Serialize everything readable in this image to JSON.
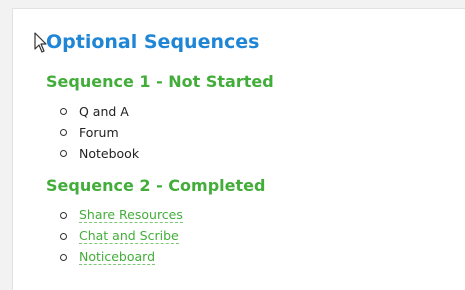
{
  "page_title": "Optional Sequences",
  "sequences": [
    {
      "heading": "Sequence 1 - Not Started",
      "activities": [
        {
          "label": "Q and A"
        },
        {
          "label": "Forum"
        },
        {
          "label": "Notebook"
        }
      ]
    },
    {
      "heading": "Sequence 2 - Completed",
      "activities": [
        {
          "label": "Share Resources"
        },
        {
          "label": "Chat and Scribe"
        },
        {
          "label": "Noticeboard"
        }
      ]
    }
  ],
  "colors": {
    "title": "#1f86d6",
    "sequence_heading": "#43ad3a",
    "link": "#43ad3a",
    "text": "#222222"
  },
  "icons": {
    "cursor": "mouse-pointer-icon",
    "bullet": "circle-bullet-icon"
  }
}
